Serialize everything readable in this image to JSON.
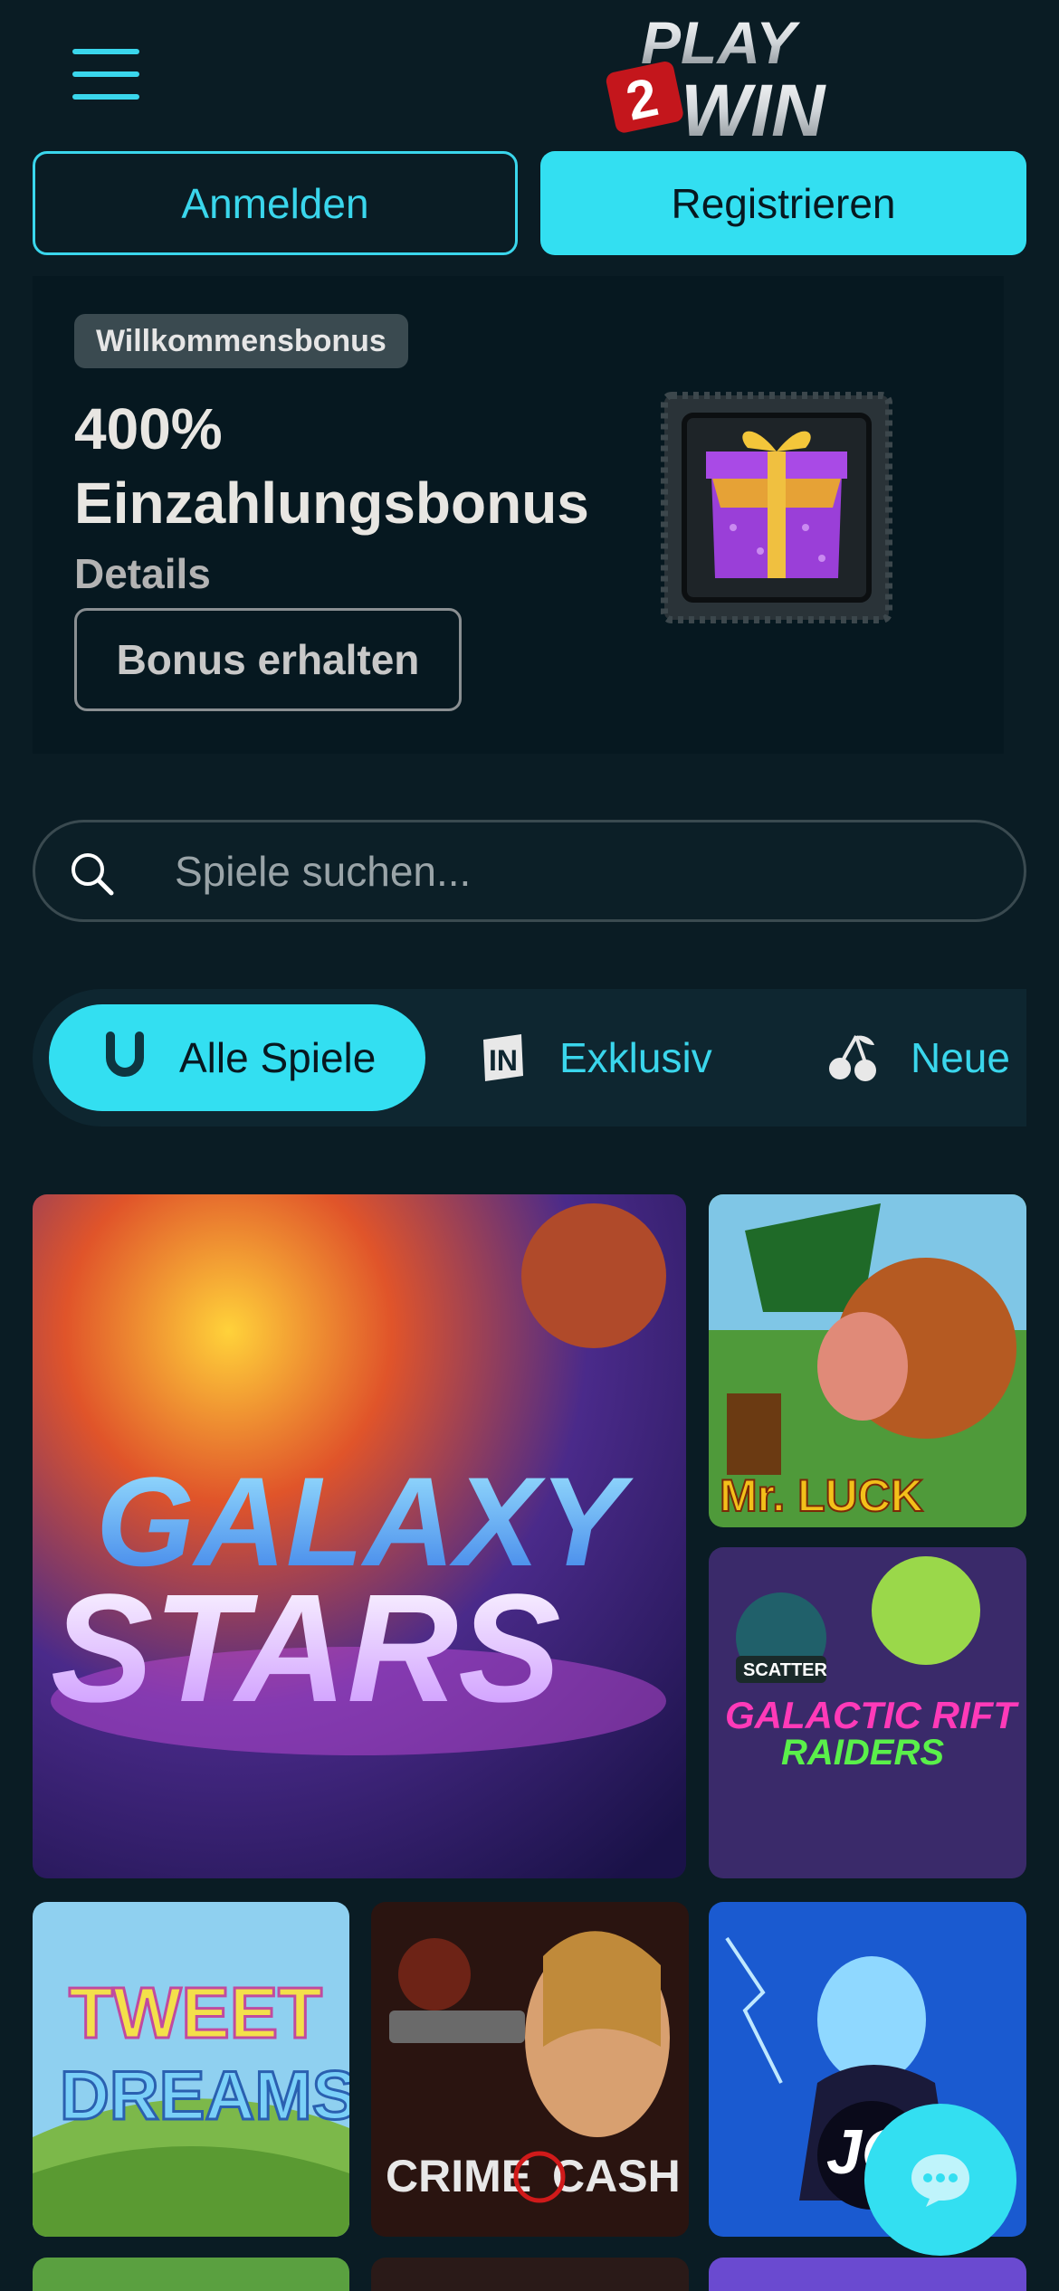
{
  "header": {
    "logo_alt": "Play 2 Win",
    "logo_lines": [
      "PLAY",
      "2",
      "WIN"
    ],
    "menu_icon": "hamburger-icon"
  },
  "auth": {
    "login_label": "Anmelden",
    "register_label": "Registrieren"
  },
  "promo": {
    "badge": "Willkommensbonus",
    "title_line1": "400%",
    "title_line2": "Einzahlungsbonus",
    "details": "Details",
    "cta": "Bonus erhalten",
    "image_icon": "gift-box-icon"
  },
  "search": {
    "placeholder": "Spiele suchen..."
  },
  "categories": [
    {
      "label": "Alle Spiele",
      "icon": "horseshoe-icon",
      "active": true
    },
    {
      "label": "Exklusiv",
      "icon": "exclusive-in-icon",
      "active": false
    },
    {
      "label": "Neue",
      "icon": "cherries-icon",
      "active": false
    }
  ],
  "games": [
    {
      "title_lines": [
        "GALAXY",
        "STARS"
      ]
    },
    {
      "title_lines": [
        "Mr. LUCK"
      ]
    },
    {
      "title_lines": [
        "SCATTER",
        "GALACTIC RIFT",
        "RAIDERS"
      ]
    },
    {
      "title_lines": [
        "TWEET",
        "DREAMS"
      ]
    },
    {
      "title_lines": [
        "CRIME",
        "CASH"
      ]
    },
    {
      "title_lines": [
        "JO"
      ]
    }
  ],
  "colors": {
    "background": "#0a1c24",
    "accent": "#33dff1",
    "promo_bg": "#061820"
  },
  "chat": {
    "icon": "chat-bubble-icon"
  }
}
